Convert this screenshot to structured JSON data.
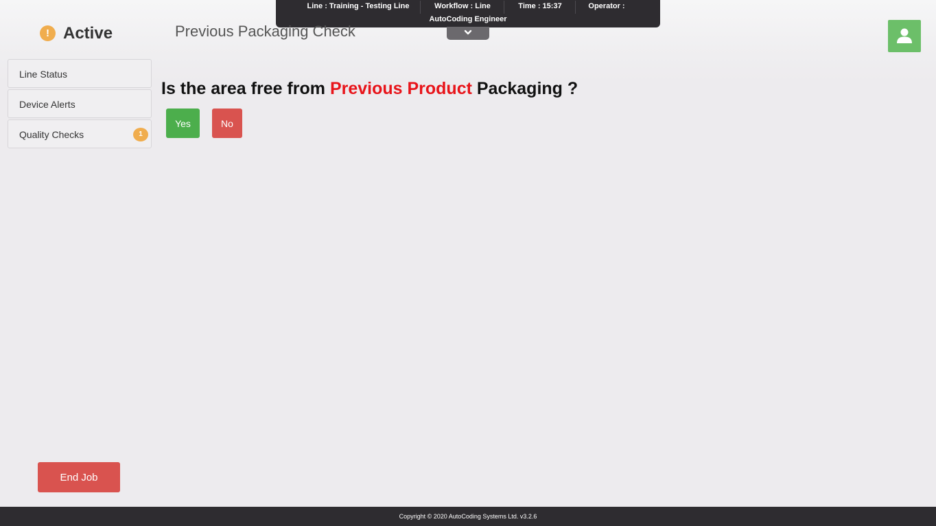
{
  "info_bar": {
    "line": "Line : Training - Testing Line",
    "workflow": "Workflow : Line",
    "time": "Time : 15:37",
    "operator": "Operator :",
    "operator_name": "AutoCoding Engineer"
  },
  "header": {
    "status_icon": "!",
    "status_label": "Active",
    "page_title": "Previous Packaging Check"
  },
  "sidebar": {
    "items": [
      {
        "label": "Line Status"
      },
      {
        "label": "Device Alerts"
      },
      {
        "label": "Quality Checks",
        "badge": "1"
      }
    ]
  },
  "question": {
    "prefix": "Is the area free from ",
    "highlight": "Previous Product",
    "suffix": " Packaging ?",
    "yes_label": "Yes",
    "no_label": "No"
  },
  "actions": {
    "end_job_label": "End Job"
  },
  "footer": {
    "copyright": "Copyright © 2020 AutoCoding Systems Ltd. v3.2.6"
  },
  "colors": {
    "accent_warning": "#f0ad4e",
    "success": "#4cae4c",
    "danger": "#d9534f",
    "highlight_red": "#e8141a",
    "dark_bar": "#2e2c30",
    "user_green": "#6cbf69"
  },
  "icons": {
    "status": "exclamation-circle-icon",
    "toggle": "chevron-down-icon",
    "user": "user-icon"
  }
}
